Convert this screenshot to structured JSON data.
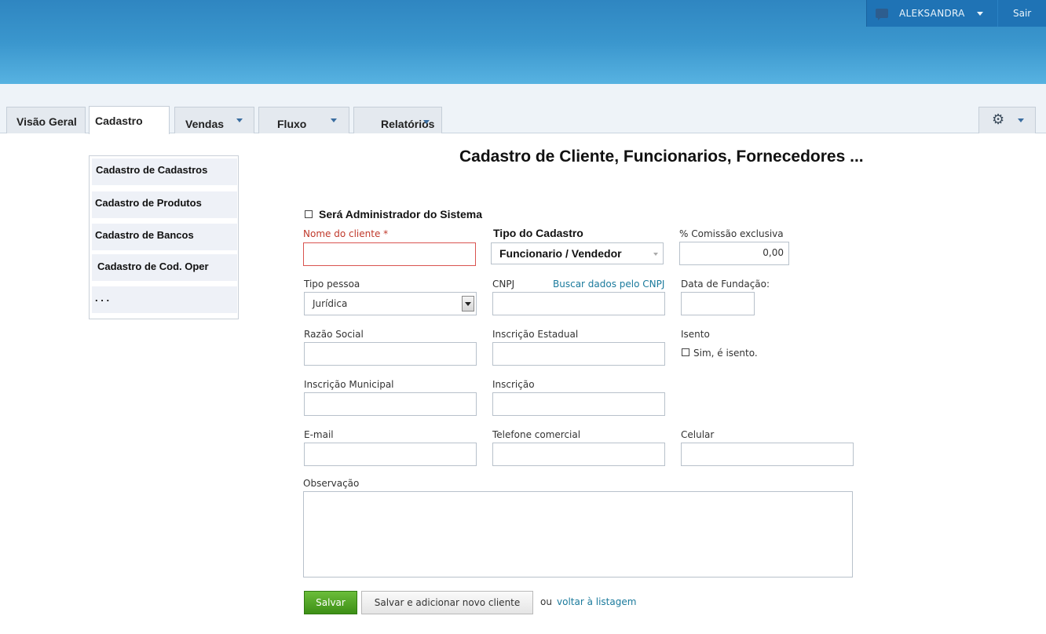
{
  "header": {
    "username": "ALEKSANDRA",
    "logout_label": "Sair"
  },
  "tabs": [
    {
      "label": "Visão Geral"
    },
    {
      "label": "Cadastro"
    },
    {
      "label": "Vendas"
    },
    {
      "label": "Fluxo"
    },
    {
      "label": "Relatórios"
    }
  ],
  "dropdown": {
    "items": [
      {
        "label": "Cadastro de Cadastros"
      },
      {
        "label": "Cadastro de Produtos"
      },
      {
        "label": "Cadastro de Bancos"
      },
      {
        "label": "Cadastro de Cod. Oper"
      },
      {
        "label": ". . ."
      }
    ]
  },
  "form": {
    "title": "Cadastro de Cliente, Funcionarios, Fornecedores ...",
    "admin_checkbox_label": "Será Administrador do Sistema",
    "nome_label": "Nome do cliente",
    "nome_required_mark": "*",
    "tipo_cadastro_label": "Tipo do Cadastro",
    "tipo_cadastro_value": "Funcionario / Vendedor",
    "comissao_label": "% Comissão exclusiva",
    "comissao_value": "0,00",
    "tipo_pessoa_label": "Tipo pessoa",
    "tipo_pessoa_value": "Jurídica",
    "cnpj_label": "CNPJ",
    "buscar_cnpj_link": "Buscar dados pelo CNPJ",
    "data_fundacao_label": "Data de Fundação:",
    "razao_social_label": "Razão Social",
    "inscricao_estadual_label": "Inscrição Estadual",
    "isento_label": "Isento",
    "isento_checkbox_label": "Sim, é isento.",
    "inscricao_municipal_label": "Inscrição Municipal",
    "inscricao_label": "Inscrição",
    "email_label": "E-mail",
    "telefone_label": "Telefone comercial",
    "celular_label": "Celular",
    "observacao_label": "Observação"
  },
  "actions": {
    "save_label": "Salvar",
    "save_add_label": "Salvar e adicionar novo cliente",
    "or_text": "ou",
    "back_link": "voltar à listagem"
  }
}
